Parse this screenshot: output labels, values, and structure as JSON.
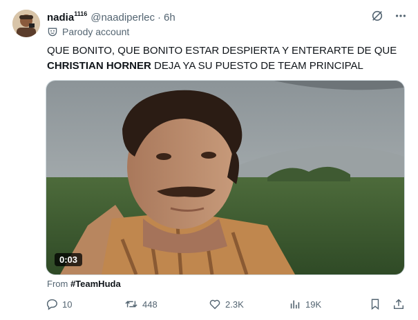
{
  "author": {
    "display_name": "nadia",
    "name_superscript": "1116",
    "handle": "@naadiperlec",
    "time": "6h",
    "label": "Parody account"
  },
  "post": {
    "text_line1": "QUE BONITO, QUE BONITO ESTAR DESPIERTA Y ENTERARTE DE QUE",
    "text_bold": "CHRISTIAN HORNER",
    "text_line2_rest": " DEJA YA SU PUESTO DE TEAM PRINCIPAL"
  },
  "media": {
    "duration": "0:03"
  },
  "source": {
    "prefix": "From ",
    "community": "#TeamHuda"
  },
  "actions": {
    "replies": "10",
    "reposts": "448",
    "likes": "2.3K",
    "views": "19K"
  },
  "colors": {
    "text": "#0f1419",
    "secondary": "#536471",
    "border": "#cfd9de"
  }
}
